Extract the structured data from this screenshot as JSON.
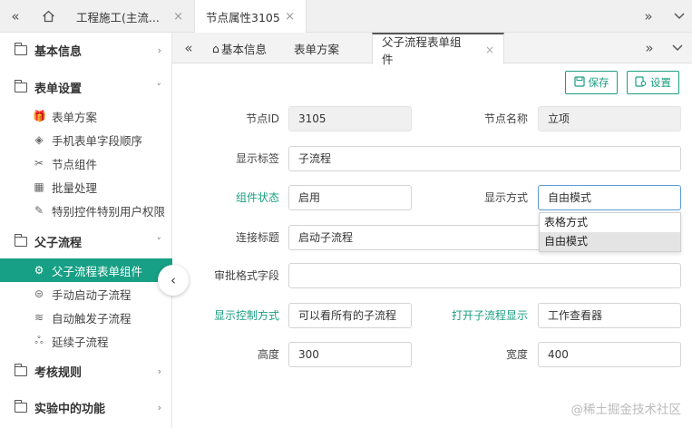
{
  "topbar": {
    "back_icon": "double-chevron-left",
    "home_icon": "home",
    "tabs": [
      {
        "label": "工程施工(主流..."
      },
      {
        "label": "节点属性3105"
      }
    ],
    "close_symbol": "×",
    "forward_icon": "double-chevron-right",
    "dropdown_icon": "chevron-down"
  },
  "sidebar": {
    "groups": [
      {
        "label": "基本信息",
        "chevron": "›"
      },
      {
        "label": "表单设置",
        "chevron": "˅"
      },
      {
        "label": "父子流程",
        "chevron": "˅"
      },
      {
        "label": "考核规则",
        "chevron": "›"
      },
      {
        "label": "实验中的功能",
        "chevron": "›"
      }
    ],
    "form_items": [
      {
        "label": "表单方案",
        "icon": "🎁"
      },
      {
        "label": "手机表单字段顺序",
        "icon": "◈"
      },
      {
        "label": "节点组件",
        "icon": "✂"
      },
      {
        "label": "批量处理",
        "icon": "▦"
      },
      {
        "label": "特别控件特别用户权限",
        "icon": "✎"
      }
    ],
    "flow_items": [
      {
        "label": "父子流程表单组件",
        "icon": "⚙"
      },
      {
        "label": "手动启动子流程",
        "icon": "⊜"
      },
      {
        "label": "自动触发子流程",
        "icon": "≋"
      },
      {
        "label": "延续子流程",
        "icon": "ஃ"
      }
    ],
    "collapse_symbol": "‹"
  },
  "inner_tabs": {
    "home_symbol": "⌂",
    "tabs": [
      {
        "label": "基本信息"
      },
      {
        "label": "表单方案"
      },
      {
        "label": "父子流程表单组件"
      }
    ],
    "close_symbol": "×"
  },
  "actions": {
    "save_label": "保存",
    "settings_label": "设置"
  },
  "form": {
    "node_id": {
      "label": "节点ID",
      "value": "3105"
    },
    "node_name": {
      "label": "节点名称",
      "value": "立项"
    },
    "display_tag": {
      "label": "显示标签",
      "value": "子流程"
    },
    "component_status": {
      "label": "组件状态",
      "value": "启用"
    },
    "display_mode": {
      "label": "显示方式",
      "value": "自由模式",
      "options": [
        "表格方式",
        "自由模式"
      ]
    },
    "connect_title": {
      "label": "连接标题",
      "value": "启动子流程"
    },
    "approval_field": {
      "label": "审批格式字段",
      "value": ""
    },
    "display_control": {
      "label": "显示控制方式",
      "value": "可以看所有的子流程"
    },
    "open_sub_display": {
      "label": "打开子流程显示",
      "value": "工作查看器"
    },
    "height": {
      "label": "高度",
      "value": "300"
    },
    "width": {
      "label": "宽度",
      "value": "400"
    }
  },
  "watermark": "@稀土掘金技术社区",
  "colors": {
    "accent": "#17a085",
    "link": "#1a9e82"
  }
}
